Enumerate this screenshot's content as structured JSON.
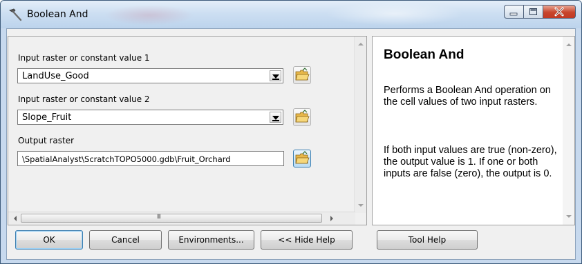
{
  "window": {
    "title": "Boolean And",
    "icon": "hammer-icon"
  },
  "title_buttons": {
    "minimize_icon": "minimize-icon",
    "maximize_icon": "maximize-icon",
    "close_icon": "close-icon"
  },
  "params": {
    "input1": {
      "label": "Input raster or constant value 1",
      "value": "LandUse_Good"
    },
    "input2": {
      "label": "Input raster or constant value 2",
      "value": "Slope_Fruit"
    },
    "output": {
      "label": "Output raster",
      "value": "\\SpatialAnalyst\\ScratchTOPO5000.gdb\\Fruit_Orchard"
    },
    "browse_icon": "open-folder-icon",
    "hscroll_grip": "III"
  },
  "help": {
    "title": "Boolean And",
    "paragraph1": "Performs a Boolean And operation on the cell values of two input rasters.",
    "paragraph2": "If both input values are true (non-zero), the output value is 1. If one or both inputs are false (zero), the output is 0."
  },
  "buttons": {
    "ok": "OK",
    "cancel": "Cancel",
    "environments": "Environments...",
    "hide_help": "<< Hide Help",
    "tool_help": "Tool Help"
  }
}
